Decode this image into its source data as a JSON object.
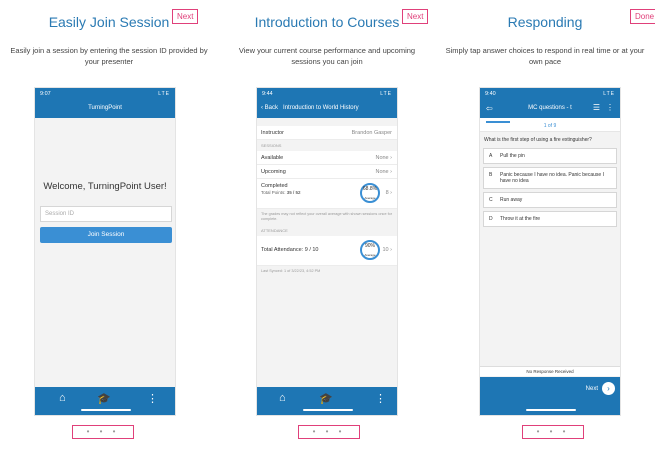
{
  "panels": [
    {
      "title": "Easily Join Session",
      "button": "Next",
      "description": "Easily join a session by entering the session ID provided by your presenter"
    },
    {
      "title": "Introduction to Courses",
      "button": "Next",
      "description": "View your current course performance and upcoming sessions you can join"
    },
    {
      "title": "Responding",
      "button": "Done",
      "description": "Simply tap answer choices to respond in real time or at your own pace"
    }
  ],
  "phone1": {
    "time": "9:07",
    "status": "LTE",
    "title": "TurningPoint",
    "welcome": "Welcome, TurningPoint User!",
    "session_placeholder": "Session ID",
    "join": "Join Session"
  },
  "phone2": {
    "time": "9:44",
    "status": "LTE",
    "back": "Back",
    "title": "Introduction to World History",
    "instructor_label": "Instructor",
    "instructor": "Brandon Gasper",
    "sessions_header": "SESSIONS",
    "available": "Available",
    "available_val": "None",
    "upcoming": "Upcoming",
    "upcoming_val": "None",
    "completed": "Completed",
    "total_points": "Total Points:",
    "points": "35 / 52",
    "perf": "68.8%",
    "perf_sub": "Average",
    "completed_count": "8",
    "note1": "The grades may not reflect your overall average with shown sessions once for complete.",
    "attendance_header": "ATTENDANCE",
    "attendance": "Total Attendance: 9 / 10",
    "att_pct": "90%",
    "att_sub": "Average",
    "att_count": "10",
    "last_sync": "Last Synced: 1 of 3/22/23, 4:52 PM"
  },
  "phone3": {
    "time": "9:40",
    "status": "LTE",
    "title": "MC questions - t",
    "progress": "1 of 9",
    "question": "What is the first step of using a fire extinguisher?",
    "answers": [
      {
        "letter": "A",
        "text": "Pull the pin"
      },
      {
        "letter": "B",
        "text": "Panic because I have no idea. Panic because I have no idea"
      },
      {
        "letter": "C",
        "text": "Run away"
      },
      {
        "letter": "D",
        "text": "Throw it at the fire"
      }
    ],
    "no_response": "No Response Received",
    "next": "Next"
  },
  "pager": [
    "• • •",
    "• • •",
    "• • •"
  ]
}
